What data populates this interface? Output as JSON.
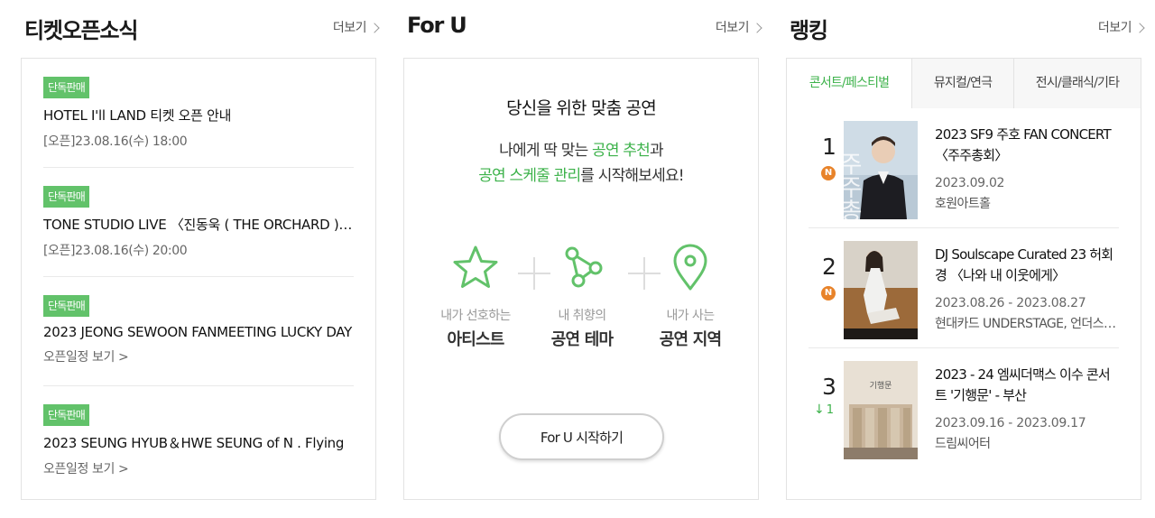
{
  "ticket_open": {
    "title": "티켓오픈소식",
    "more": "더보기",
    "items": [
      {
        "badge": "단독판매",
        "title": "HOTEL I'll LAND 티켓 오픈 안내",
        "sub": "[오픈]23.08.16(수) 18:00"
      },
      {
        "badge": "단독판매",
        "title": "TONE STUDIO LIVE 〈진동욱 ( THE ORCHARD ) 〉",
        "sub": "[오픈]23.08.16(수) 20:00"
      },
      {
        "badge": "단독판매",
        "title": "2023 JEONG SEWOON FANMEETING LUCKY DAY",
        "sub": "오픈일정 보기 >"
      },
      {
        "badge": "단독판매",
        "title": "2023 SEUNG HYUB＆HWE SEUNG of N . Flying",
        "sub": "오픈일정 보기 >"
      }
    ]
  },
  "foru": {
    "title": "For U",
    "more": "더보기",
    "heading": "당신을 위한 맞춤 공연",
    "desc_prefix": "나에게 딱 맞는 ",
    "desc_green1": "공연 추천",
    "desc_mid": "과",
    "desc_green2": "공연 스케줄 관리",
    "desc_suffix": "를 시작해보세요!",
    "steps": [
      {
        "icon": "star-icon",
        "sub": "내가 선호하는",
        "main": "아티스트"
      },
      {
        "icon": "share-nodes-icon",
        "sub": "내 취향의",
        "main": "공연 테마"
      },
      {
        "icon": "location-pin-icon",
        "sub": "내가 사는",
        "main": "공연 지역"
      }
    ],
    "button": "For U 시작하기",
    "accent": "#3cb24a",
    "icon_color": "#62c26a"
  },
  "ranking": {
    "title": "랭킹",
    "more": "더보기",
    "tabs": [
      "콘서트/페스티벌",
      "뮤지컬/연극",
      "전시/클래식/기타"
    ],
    "active_tab": 0,
    "items": [
      {
        "rank": "1",
        "status": "N",
        "title": "2023 SF9 주호 FAN CONCERT 〈주주총회〉",
        "date": "2023.09.02",
        "venue": "호원아트홀"
      },
      {
        "rank": "2",
        "status": "N",
        "title": "DJ Soulscape Curated 23 허회경 〈나와 내 이웃에게〉",
        "date": "2023.08.26 - 2023.08.27",
        "venue": "현대카드 UNDERSTAGE, 언더스테이지"
      },
      {
        "rank": "3",
        "status": "1",
        "title": "2023 - 24 엠씨더맥스 이수 콘서트 '기행문' - 부산",
        "date": "2023.09.16 - 2023.09.17",
        "venue": "드림씨어터"
      }
    ],
    "poster_labels": [
      "주주총회",
      "",
      "기행문"
    ],
    "new_color": "#e8832a",
    "down_color": "#3cb24a"
  }
}
